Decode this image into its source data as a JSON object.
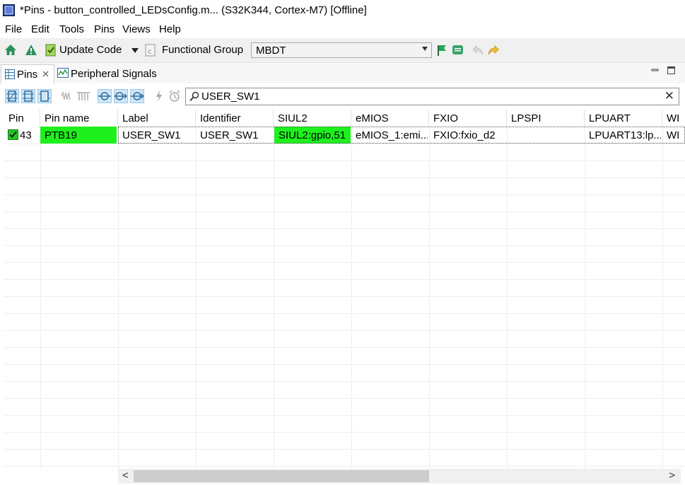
{
  "window": {
    "title": "*Pins - button_controlled_LEDsConfig.m... (S32K344, Cortex-M7) [Offline]"
  },
  "menu": [
    "File",
    "Edit",
    "Tools",
    "Pins",
    "Views",
    "Help"
  ],
  "toolbar": {
    "update_code_label": "Update Code",
    "functional_group_label": "Functional Group",
    "functional_group_value": "MBDT"
  },
  "tabs": [
    {
      "label": "Pins",
      "active": true
    },
    {
      "label": "Peripheral Signals",
      "active": false
    }
  ],
  "search": {
    "value": "USER_SW1"
  },
  "table": {
    "headers": [
      "Pin",
      "Pin name",
      "Label",
      "Identifier",
      "SIUL2",
      "eMIOS",
      "FXIO",
      "LPSPI",
      "LPUART",
      "WI"
    ],
    "rows": [
      {
        "checked": true,
        "pin": "43",
        "pin_name": "PTB19",
        "label": "USER_SW1",
        "identifier": "USER_SW1",
        "siul2": "SIUL2:gpio,51",
        "emios": "eMIOS_1:emi...",
        "fxio": "FXIO:fxio_d2",
        "lpspi": "",
        "lpuart": "LPUART13:lp...",
        "wi": "WI"
      }
    ]
  },
  "colors": {
    "highlight_green": "#1ef01e",
    "toolbar_bg": "#f0f0f0",
    "selection_blue": "#cfe6f6"
  },
  "icons": [
    "app-chip-icon",
    "home-icon",
    "warning-icon",
    "update-code-icon",
    "dropdown-arrow-icon",
    "functional-group-icon",
    "flag-icon",
    "tag-icon",
    "undo-icon",
    "redo-icon",
    "table-icon",
    "close-tab-icon",
    "peripheral-signals-icon",
    "minimize-icon",
    "maximize-icon",
    "search-icon",
    "clear-icon"
  ]
}
